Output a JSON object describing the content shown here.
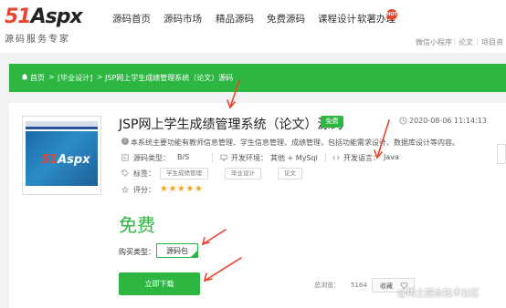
{
  "logo": {
    "main_a": "51",
    "main_b": "Aspx",
    "subtitle": "源码服务专家"
  },
  "nav": {
    "items": [
      "源码首页",
      "源码市场",
      "精品源码",
      "免费源码",
      "课程设计",
      "软著办理"
    ],
    "hot_badge": "HOT",
    "sub_links": [
      "微信小程序",
      "论文",
      "项目资"
    ]
  },
  "breadcrumb": [
    "首页",
    "毕业设计",
    "JSP网上学生成绩管理系统（论文）源码"
  ],
  "product": {
    "title": "JSP网上学生成绩管理系统（论文）源码",
    "badge": "免费",
    "date": "2020-08-06 11:14:13",
    "description": "本系统主要功能有教师信息管理、学生信息管理、成绩管理，包括功能需求设计、数据库设计等内容。",
    "type_label": "源码类型：",
    "type_value": "B/S",
    "env_label": "开发环境：",
    "env_value": "其他 + MySql",
    "lang_label": "开发语言：",
    "lang_value": "Java",
    "tags_label": "标签：",
    "tags": [
      "学生成绩管理",
      "毕业设计",
      "论文"
    ],
    "rating_label": "评分：",
    "rating_stars": "★★★★★",
    "rating": 5,
    "price": "免费",
    "buy_type_label": "购买类型：",
    "buy_type_option": "源码包",
    "download_label": "立即下载",
    "views_label": "总浏览：",
    "views_value": "5164",
    "favorite_label": "收藏",
    "thumb_logo_a": "51",
    "thumb_logo_b": "Aspx"
  },
  "watermark": "@稀土掘金技术社区",
  "colors": {
    "accent": "#2db742",
    "brand_red": "#e8442e",
    "arrow": "#e8442e",
    "star": "#f5a623"
  },
  "icons": [
    "home-icon",
    "clock-icon",
    "info-icon",
    "code-icon",
    "monitor-icon",
    "language-icon",
    "tag-icon",
    "star-icon",
    "heart-icon"
  ]
}
